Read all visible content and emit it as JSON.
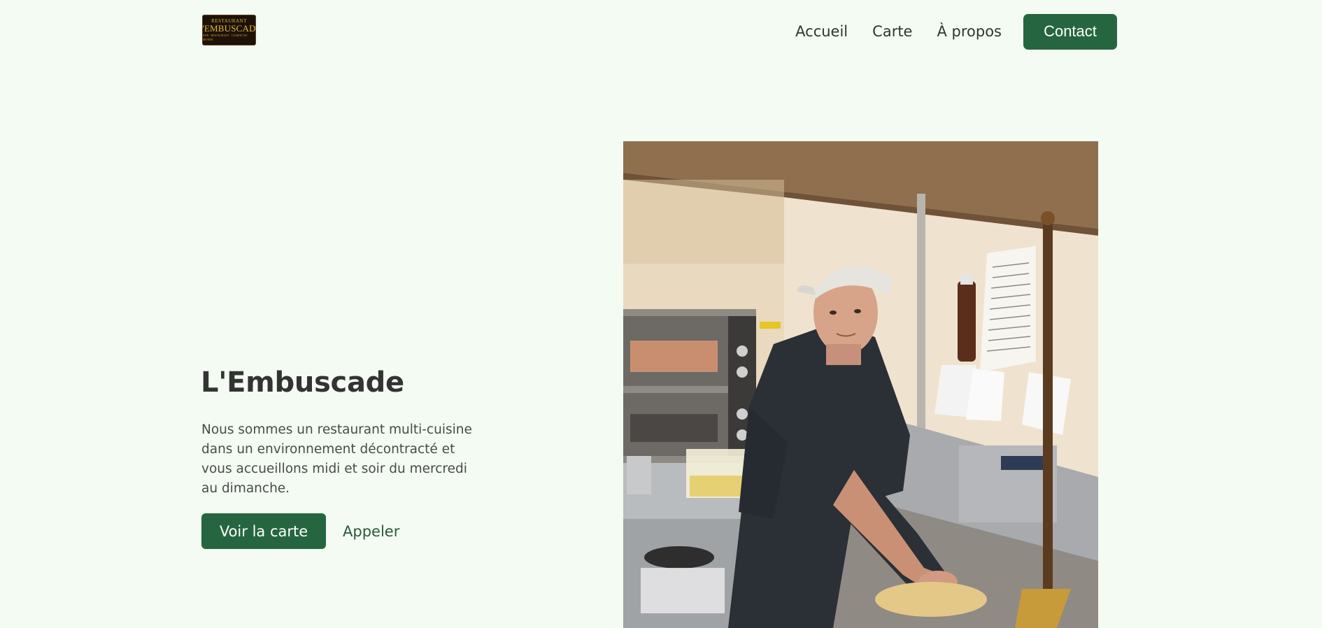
{
  "header": {
    "logo": {
      "top": "RESTAURANT",
      "main": "L'EMBUSCADE",
      "sub": "BAR · RESTAURANT · CUISINE DU MONDE"
    },
    "nav": [
      {
        "label": "Accueil"
      },
      {
        "label": "Carte"
      },
      {
        "label": "À propos"
      }
    ],
    "contact_label": "Contact"
  },
  "hero": {
    "title": "L'Embuscade",
    "description": "Nous sommes un restaurant multi-cuisine dans un environnement décontracté et vous accueillons midi et soir du mercredi au dimanche.",
    "primary_button": "Voir la carte",
    "secondary_button": "Appeler"
  },
  "colors": {
    "background": "#f3fbf2",
    "accent": "#256640",
    "text": "#333333"
  }
}
